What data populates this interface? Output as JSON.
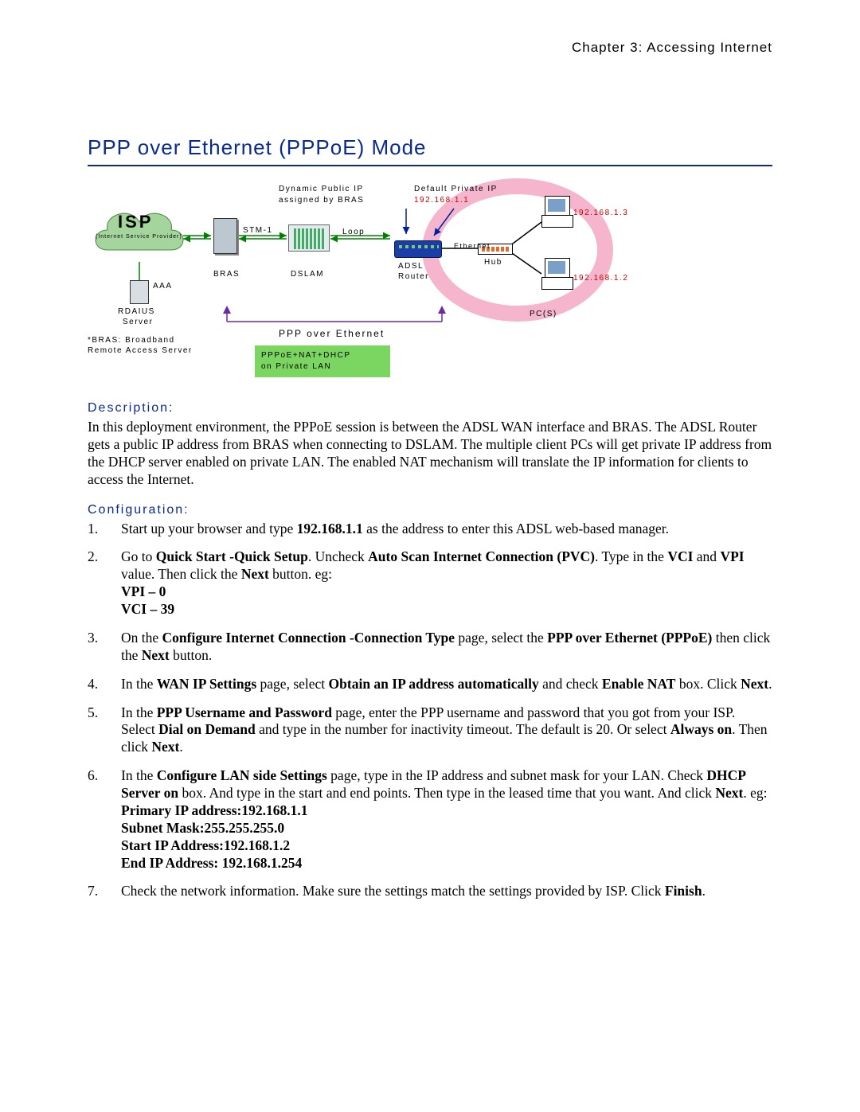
{
  "header": {
    "chapter": "Chapter 3: Accessing Internet"
  },
  "title": "PPP over Ethernet (PPPoE) Mode",
  "diagram": {
    "isp": {
      "label": "ISP",
      "sub": "(Internet Service Provider)"
    },
    "radius": {
      "name": "RDAIUS",
      "sub": "Server",
      "link": "AAA"
    },
    "bras_note_l1": "*BRAS: Broadband",
    "bras_note_l2": "Remote Access Server",
    "stm": "STM-1",
    "bras": "BRAS",
    "dslam": "DSLAM",
    "loop": "Loop",
    "dyn_ip_l1": "Dynamic Public IP",
    "dyn_ip_l2": "assigned by BRAS",
    "adsl_router_l1": "ADSL",
    "adsl_router_l2": "Router",
    "ppp_caption": "PPP over Ethernet",
    "green_l1": "PPPoE+NAT+DHCP",
    "green_l2": "on Private LAN",
    "default_ip_l1": "Default Private IP",
    "default_ip_l2": "192.168.1.1",
    "hub": "Hub",
    "ethernet": "Ethernet",
    "pc1_ip": "192.168.1.3",
    "pc2_ip": "192.168.1.2",
    "pcs": "PC(S)"
  },
  "description": {
    "heading": "Description:",
    "text": "In this deployment environment, the PPPoE session is between the ADSL WAN interface and BRAS. The ADSL Router gets a public IP address from BRAS when connecting to DSLAM. The multiple client PCs will get private IP address from the DHCP server enabled on private LAN. The enabled NAT mechanism will translate the IP information for clients to access the Internet."
  },
  "configuration": {
    "heading": "Configuration:",
    "steps": {
      "s1a": "Start up your browser and type ",
      "s1b": "192.168.1.1",
      "s1c": " as the address to enter this ADSL web-based manager.",
      "s2a": "Go to ",
      "s2b": "Quick Start -Quick Setup",
      "s2c": ". Uncheck ",
      "s2d": "Auto Scan Internet Connection (PVC)",
      "s2e": ". Type in the ",
      "s2f": "VCI",
      "s2g": " and ",
      "s2h": "VPI",
      "s2i": " value. Then click the ",
      "s2j": "Next",
      "s2k": " button. eg:",
      "s2l": "VPI – 0",
      "s2m": "VCI – 39",
      "s3a": "On the ",
      "s3b": "Configure Internet Connection -Connection Type",
      "s3c": " page, select the ",
      "s3d": "PPP over Ethernet (PPPoE)",
      "s3e": " then click the ",
      "s3f": "Next",
      "s3g": " button.",
      "s4a": "In the ",
      "s4b": "WAN IP Settings",
      "s4c": " page, select ",
      "s4d": "Obtain an IP address automatically",
      "s4e": " and check ",
      "s4f": "Enable NAT",
      "s4g": " box. Click ",
      "s4h": "Next",
      "s4i": ".",
      "s5a": "In the ",
      "s5b": "PPP Username and Password",
      "s5c": " page, enter the PPP username and password that you got from your ISP. Select ",
      "s5d": "Dial on Demand",
      "s5e": " and type in the number for inactivity timeout. The default is 20. Or select ",
      "s5f": "Always on",
      "s5g": ". Then click ",
      "s5h": "Next",
      "s5i": ".",
      "s6a": "In the ",
      "s6b": "Configure LAN side Settings",
      "s6c": " page, type in the IP address and subnet mask for your LAN. Check ",
      "s6d": "DHCP Server on",
      "s6e": " box. And type in the start and end points. Then type in the leased time that you want. And click ",
      "s6f": "Next",
      "s6g": ". eg:",
      "s6h": "Primary IP address:192.168.1.1",
      "s6i": "Subnet Mask:255.255.255.0",
      "s6j": "Start IP Address:192.168.1.2",
      "s6k": "End IP Address: 192.168.1.254",
      "s7a": "Check the network information. Make sure the settings match the settings provided by ISP. Click ",
      "s7b": "Finish",
      "s7c": "."
    }
  }
}
